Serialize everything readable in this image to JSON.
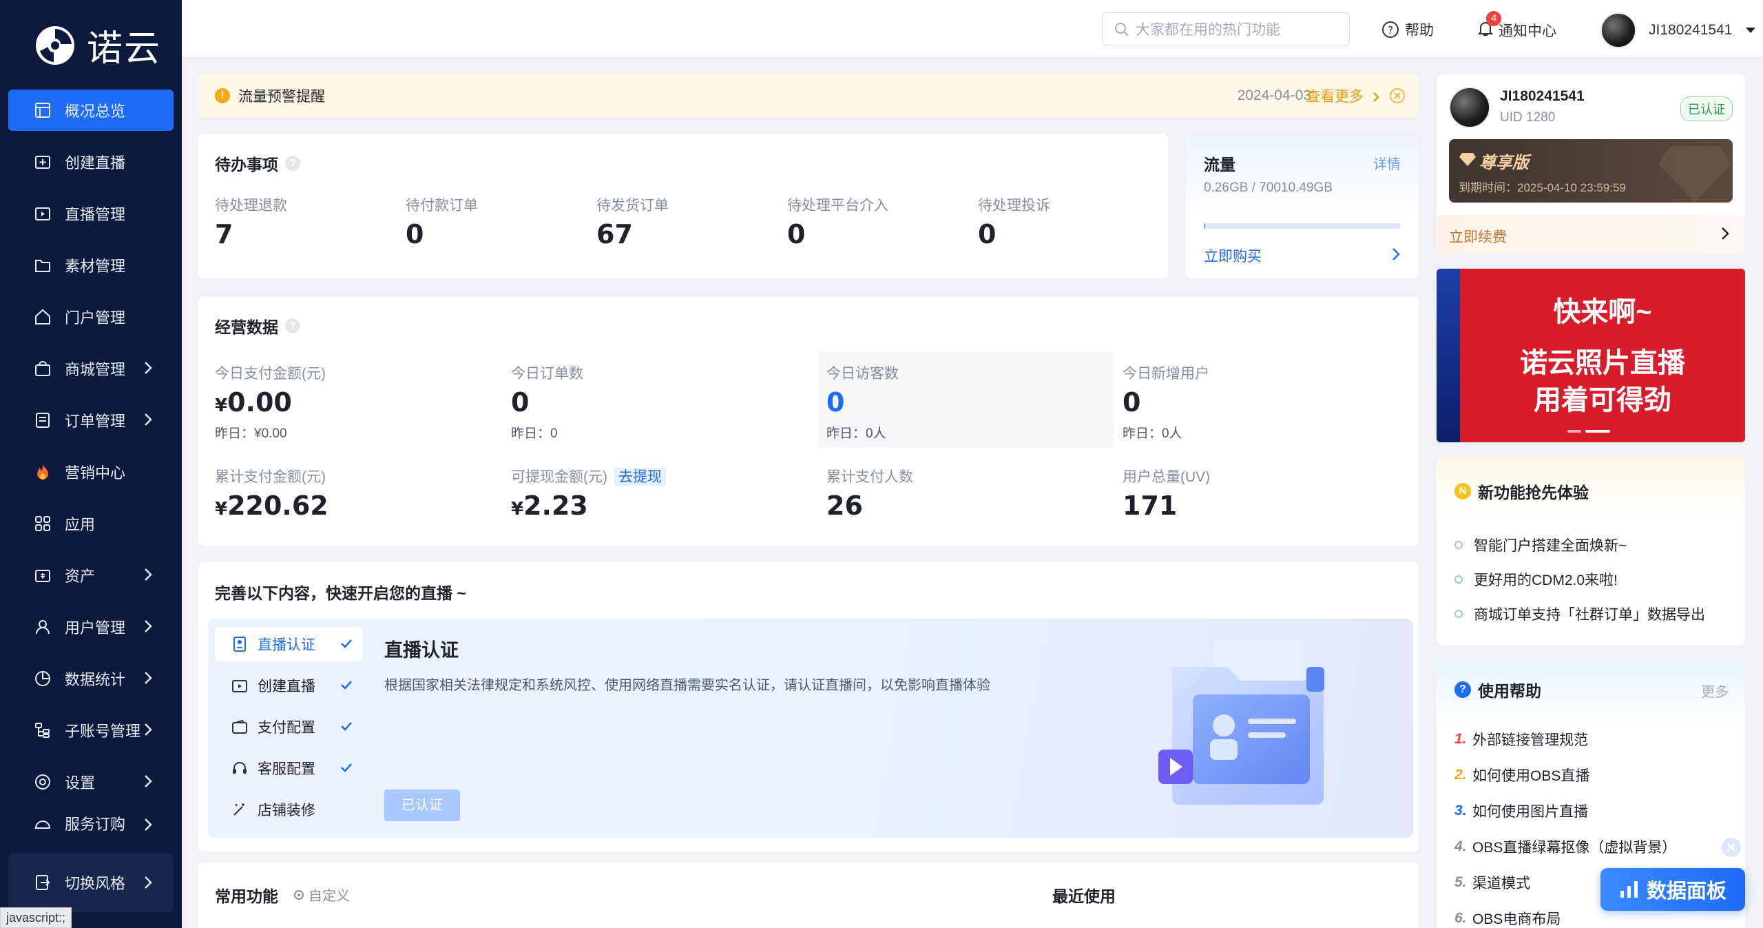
{
  "app": {
    "logo_text": "诺云"
  },
  "sidebar": {
    "items": [
      {
        "label": "概况总览",
        "icon": "dashboard-icon",
        "active": true,
        "chevron": false
      },
      {
        "label": "创建直播",
        "icon": "add-live-icon",
        "active": false,
        "chevron": false
      },
      {
        "label": "直播管理",
        "icon": "live-manage-icon",
        "active": false,
        "chevron": false
      },
      {
        "label": "素材管理",
        "icon": "folder-icon",
        "active": false,
        "chevron": false
      },
      {
        "label": "门户管理",
        "icon": "home-icon",
        "active": false,
        "chevron": false
      },
      {
        "label": "商城管理",
        "icon": "shop-bag-icon",
        "active": false,
        "chevron": true
      },
      {
        "label": "订单管理",
        "icon": "order-icon",
        "active": false,
        "chevron": true
      },
      {
        "label": "营销中心",
        "icon": "fire-icon",
        "active": false,
        "chevron": false
      },
      {
        "label": "应用",
        "icon": "apps-grid-icon",
        "active": false,
        "chevron": false
      },
      {
        "label": "资产",
        "icon": "wallet-icon",
        "active": false,
        "chevron": true
      },
      {
        "label": "用户管理",
        "icon": "user-icon",
        "active": false,
        "chevron": true
      },
      {
        "label": "数据统计",
        "icon": "pie-chart-icon",
        "active": false,
        "chevron": true
      },
      {
        "label": "子账号管理",
        "icon": "sub-account-icon",
        "active": false,
        "chevron": true
      },
      {
        "label": "设置",
        "icon": "settings-icon",
        "active": false,
        "chevron": true
      },
      {
        "label": "服务订购",
        "icon": "service-icon",
        "active": false,
        "chevron": true
      }
    ],
    "switch_style": "切换风格",
    "status_text": "javascript:;"
  },
  "topbar": {
    "search_placeholder": "大家都在用的热门功能",
    "help": "帮助",
    "notify": "通知中心",
    "notify_count": "4",
    "username": "JI180241541"
  },
  "alert": {
    "text": "流量预警提醒",
    "date": "2024-04-03",
    "more": "查看更多"
  },
  "todo": {
    "title": "待办事项",
    "items": [
      {
        "label": "待处理退款",
        "value": "7"
      },
      {
        "label": "待付款订单",
        "value": "0"
      },
      {
        "label": "待发货订单",
        "value": "67"
      },
      {
        "label": "待处理平台介入",
        "value": "0"
      },
      {
        "label": "待处理投诉",
        "value": "0"
      }
    ]
  },
  "traffic": {
    "title": "流量",
    "detail": "详情",
    "usage": "0.26GB / 70010.49GB",
    "used_fraction": 3.7e-06,
    "buy": "立即购买"
  },
  "business": {
    "title": "经营数据",
    "row1": [
      {
        "label": "今日支付金额(元)",
        "prefix": "¥",
        "value": "0.00",
        "sub": "昨日：¥0.00"
      },
      {
        "label": "今日订单数",
        "prefix": "",
        "value": "0",
        "sub": "昨日：0"
      },
      {
        "label": "今日访客数",
        "prefix": "",
        "value": "0",
        "sub": "昨日：0人"
      },
      {
        "label": "今日新增用户",
        "prefix": "",
        "value": "0",
        "sub": "昨日：0人"
      }
    ],
    "row2": [
      {
        "label": "累计支付金额(元)",
        "prefix": "¥",
        "value": "220.62"
      },
      {
        "label": "可提现金额(元)",
        "prefix": "¥",
        "value": "2.23",
        "action": "去提现"
      },
      {
        "label": "累计支付人数",
        "prefix": "",
        "value": "26"
      },
      {
        "label": "用户总量(UV)",
        "prefix": "",
        "value": "171"
      }
    ]
  },
  "setup": {
    "title": "完善以下内容，快速开启您的直播 ~",
    "steps": [
      {
        "label": "直播认证",
        "done": true,
        "icon": "id-card-icon"
      },
      {
        "label": "创建直播",
        "done": true,
        "icon": "live-icon"
      },
      {
        "label": "支付配置",
        "done": true,
        "icon": "wallet-icon"
      },
      {
        "label": "客服配置",
        "done": true,
        "icon": "headset-icon"
      },
      {
        "label": "店铺装修",
        "done": false,
        "icon": "magic-wand-icon"
      }
    ],
    "detail_title": "直播认证",
    "detail_desc": "根据国家相关法律规定和系统风控、使用网络直播需要实名认证，请认证直播间，以免影响直播体验",
    "detail_button": "已认证"
  },
  "common": {
    "title": "常用功能",
    "customize": "自定义",
    "recent": "最近使用"
  },
  "profile": {
    "name": "JI180241541",
    "uid": "UID 1280",
    "verified": "已认证",
    "vip": "尊享版",
    "expire": "到期时间：2025-04-10 23:59:59",
    "renew": "立即续费"
  },
  "banner": {
    "line1": "快来啊~",
    "line2": "诺云照片直播",
    "line3": "用着可得劲"
  },
  "news": {
    "title": "新功能抢先体验",
    "items": [
      "智能门户搭建全面焕新~",
      "更好用的CDM2.0来啦!",
      "商城订单支持「社群订单」数据导出"
    ]
  },
  "help": {
    "title": "使用帮助",
    "more": "更多",
    "items": [
      {
        "num": "1.",
        "label": "外部链接管理规范",
        "color": "#f53f3f"
      },
      {
        "num": "2.",
        "label": "如何使用OBS直播",
        "color": "#f7a811"
      },
      {
        "num": "3.",
        "label": "如何使用图片直播",
        "color": "#1e6bf7"
      },
      {
        "num": "4.",
        "label": "OBS直播绿幕抠像（虚拟背景）",
        "color": "#86909c"
      },
      {
        "num": "5.",
        "label": "渠道模式",
        "color": "#86909c"
      },
      {
        "num": "6.",
        "label": "OBS电商布局",
        "color": "#86909c"
      }
    ]
  },
  "float_button": "数据面板",
  "colors": {
    "primary": "#1e6bf7",
    "sidebar": "#0d1a3d",
    "warn": "#f7a811",
    "danger": "#f53f3f"
  }
}
